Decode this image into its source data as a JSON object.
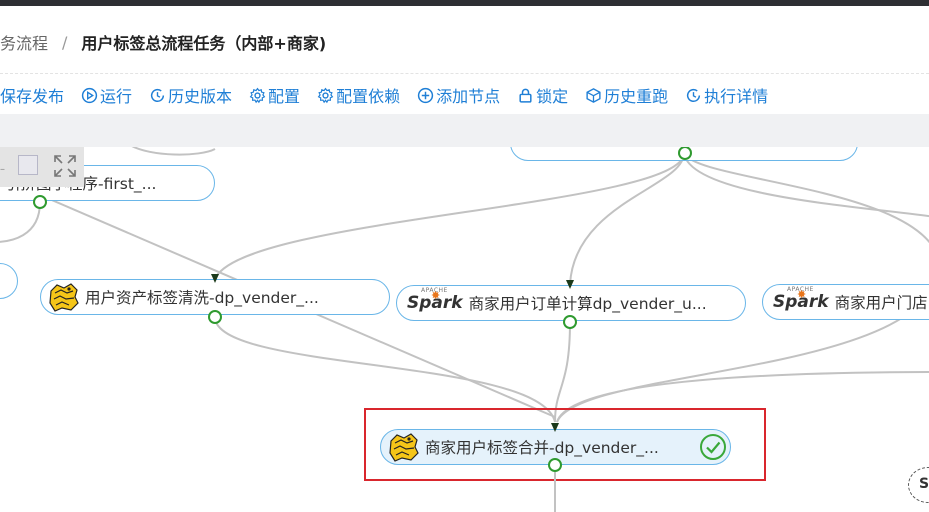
{
  "breadcrumb": {
    "prev": "务流程",
    "sep": "/",
    "current": "用户标签总流程任务（内部+商家)"
  },
  "toolbar": {
    "items": [
      {
        "label": "保存发布",
        "icon": "save-icon"
      },
      {
        "label": "运行",
        "icon": "play-icon"
      },
      {
        "label": "历史版本",
        "icon": "history-icon"
      },
      {
        "label": "配置",
        "icon": "gear-icon"
      },
      {
        "label": "配置依赖",
        "icon": "gear-icon"
      },
      {
        "label": "添加节点",
        "icon": "plus-circle-icon"
      },
      {
        "label": "锁定",
        "icon": "lock-icon"
      },
      {
        "label": "历史重跑",
        "icon": "cube-icon"
      },
      {
        "label": "执行详情",
        "icon": "clock-icon"
      }
    ]
  },
  "canvas": {
    "nodes": {
      "n_first": {
        "label": "小程序-first_...",
        "partial_prefix": "引拼图",
        "icon": "none"
      },
      "n_asset": {
        "label": "用户资产标签清洗-dp_vender_...",
        "icon": "hive-icon"
      },
      "n_order": {
        "label": "商家用户订单计算dp_vender_u...",
        "icon": "spark-icon"
      },
      "n_store": {
        "label": "商家用户门店",
        "icon": "spark-icon"
      },
      "n_merge": {
        "label": "商家用户标签合并-dp_vender_...",
        "icon": "hive-icon",
        "status": "success"
      }
    },
    "spark_text": "Spark",
    "spark_apache": "APACHE",
    "corner_badge": "S"
  },
  "colors": {
    "accent": "#1f7fd6",
    "node_border": "#6ab6e8",
    "port": "#2f9a2f",
    "selection": "#d9262d",
    "edge": "#c2c2c2"
  }
}
